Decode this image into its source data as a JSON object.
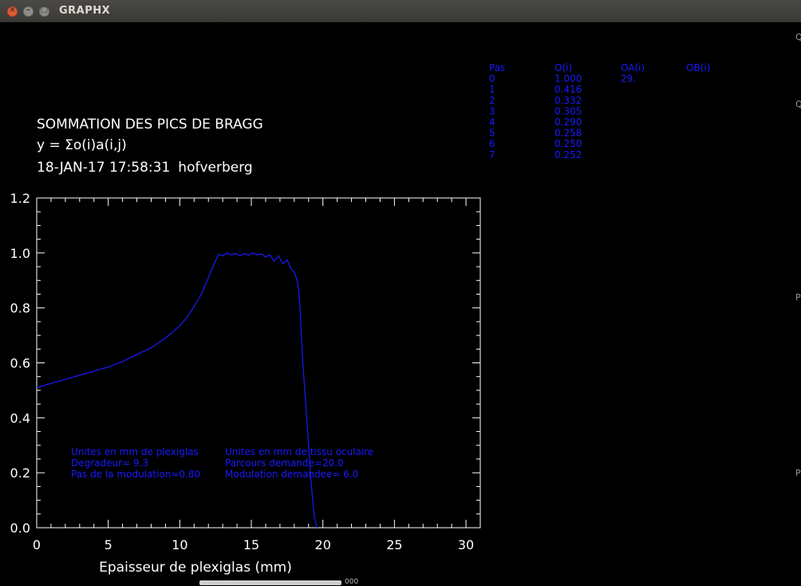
{
  "window": {
    "title": "GRAPHX",
    "close_label": "×",
    "min_label": "–",
    "max_label": "□"
  },
  "header": {
    "title": "SOMMATION DES PICS DE BRAGG",
    "formula": "y = Σo(i)a(i,j)",
    "timestamp": "18-JAN-17  17:58:31",
    "user": "hofverberg"
  },
  "table": {
    "headers": [
      "Pas",
      "O(i)",
      "OA(i)",
      "OB(i)"
    ],
    "rows": [
      [
        "0",
        "1.000",
        "29.",
        ""
      ],
      [
        "1",
        "0.416",
        "",
        ""
      ],
      [
        "2",
        "0.332",
        "",
        ""
      ],
      [
        "3",
        "0.305",
        "",
        ""
      ],
      [
        "4",
        "0.290",
        "",
        ""
      ],
      [
        "5",
        "0.258",
        "",
        ""
      ],
      [
        "6",
        "0.250",
        "",
        ""
      ],
      [
        "7",
        "0.252",
        "",
        ""
      ]
    ]
  },
  "annotations": {
    "left": [
      "Unites en mm de plexiglas",
      "Degradeur= 9.3",
      "Pas de la modulation=0.80"
    ],
    "right": [
      "Unites en mm de tissu oculaire",
      "Parcours demande=20.0",
      "Modulation demandee= 6.0"
    ]
  },
  "edge_labels": [
    "Q",
    "Q",
    "P",
    "P"
  ],
  "scroll_text": "000",
  "colors": {
    "background": "#000000",
    "axes": "#ffffff",
    "series": "#1a1aff",
    "text": "#ffffff"
  },
  "chart_data": {
    "type": "line",
    "title": "SOMMATION DES PICS DE BRAGG",
    "xlabel": "Epaisseur de plexiglas (mm)",
    "ylabel": "",
    "xlim": [
      0,
      31
    ],
    "ylim": [
      0,
      1.2
    ],
    "xticks": [
      0,
      5,
      10,
      15,
      20,
      25,
      30
    ],
    "yticks": [
      0.0,
      0.2,
      0.4,
      0.6,
      0.8,
      1.0,
      1.2
    ],
    "ytick_labels": [
      "0.0",
      "0.2",
      "0.4",
      "0.6",
      "0.8",
      "1.0",
      "1.2"
    ],
    "grid": false,
    "series": [
      {
        "x": [
          0,
          1,
          2,
          3,
          4,
          5,
          6,
          7,
          8,
          9,
          10,
          10.5,
          11,
          11.5,
          12,
          12.4,
          12.7,
          13.0,
          13.3,
          13.6,
          13.9,
          14.2,
          14.5,
          14.8,
          15.1,
          15.4,
          15.7,
          16.0,
          16.3,
          16.6,
          16.9,
          17.2,
          17.5,
          17.8,
          18.0,
          18.2,
          18.3,
          18.4,
          18.5,
          18.6,
          18.8,
          19.0,
          19.2,
          19.4,
          19.6
        ],
        "y": [
          0.51,
          0.525,
          0.54,
          0.555,
          0.57,
          0.585,
          0.605,
          0.63,
          0.655,
          0.69,
          0.735,
          0.765,
          0.805,
          0.85,
          0.91,
          0.96,
          0.995,
          0.99,
          1.0,
          0.993,
          0.998,
          0.99,
          0.997,
          0.992,
          1.0,
          0.993,
          0.997,
          0.985,
          0.993,
          0.97,
          0.99,
          0.96,
          0.975,
          0.94,
          0.93,
          0.9,
          0.87,
          0.8,
          0.7,
          0.6,
          0.45,
          0.3,
          0.15,
          0.04,
          0.0
        ]
      }
    ]
  }
}
